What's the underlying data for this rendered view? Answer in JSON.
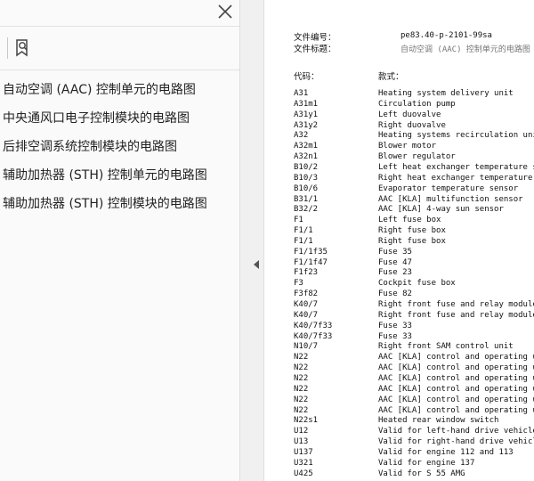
{
  "sidebar": {
    "toc": [
      "自动空调 (AAC) 控制单元的电路图",
      "中央通风口电子控制模块的电路图",
      "后排空调系统控制模块的电路图",
      "辅助加热器 (STH) 控制单元的电路图",
      "辅助加热器 (STH) 控制模块的电路图"
    ]
  },
  "document": {
    "doc_number_label": "文件编号：",
    "doc_number_value": "pe83.40-p-2101-99sa",
    "doc_title_label": "文件标题：",
    "doc_title_value": "自动空调 (AAC) 控制单元的电路图",
    "col_code": "代码：",
    "col_model": "款式：",
    "rows": [
      {
        "code": "A31",
        "desc": "Heating system delivery unit"
      },
      {
        "code": "A31m1",
        "desc": "Circulation pump"
      },
      {
        "code": "A31y1",
        "desc": "Left duovalve"
      },
      {
        "code": "A31y2",
        "desc": "Right duovalve"
      },
      {
        "code": "A32",
        "desc": "Heating systems recirculation unit"
      },
      {
        "code": "A32m1",
        "desc": "Blower motor"
      },
      {
        "code": "A32n1",
        "desc": "Blower regulator"
      },
      {
        "code": "B10/2",
        "desc": "Left heat exchanger temperature sensor"
      },
      {
        "code": "B10/3",
        "desc": "Right heat exchanger temperature sensor"
      },
      {
        "code": "B10/6",
        "desc": "Evaporator temperature sensor"
      },
      {
        "code": "B31/1",
        "desc": "AAC [KLA] multifunction sensor"
      },
      {
        "code": "B32/2",
        "desc": "AAC [KLA] 4-way sun sensor"
      },
      {
        "code": "F1",
        "desc": "Left fuse box"
      },
      {
        "code": "F1/1",
        "desc": "Right fuse box"
      },
      {
        "code": "F1/1",
        "desc": "Right fuse box"
      },
      {
        "code": "F1/1f35",
        "desc": "Fuse 35"
      },
      {
        "code": "F1/1f47",
        "desc": "Fuse 47"
      },
      {
        "code": "F1f23",
        "desc": "Fuse 23"
      },
      {
        "code": "F3",
        "desc": "Cockpit fuse box"
      },
      {
        "code": "F3f82",
        "desc": "Fuse 82"
      },
      {
        "code": "K40/7",
        "desc": "Right front fuse and relay module"
      },
      {
        "code": "K40/7",
        "desc": "Right front fuse and relay module"
      },
      {
        "code": "K40/7f33",
        "desc": "Fuse 33"
      },
      {
        "code": "K40/7f33",
        "desc": "Fuse 33"
      },
      {
        "code": "N10/7",
        "desc": "Right front SAM control unit"
      },
      {
        "code": "N22",
        "desc": "AAC [KLA] control and operating unit"
      },
      {
        "code": "N22",
        "desc": "AAC [KLA] control and operating unit"
      },
      {
        "code": "N22",
        "desc": "AAC [KLA] control and operating unit"
      },
      {
        "code": "N22",
        "desc": "AAC [KLA] control and operating unit"
      },
      {
        "code": "N22",
        "desc": "AAC [KLA] control and operating unit"
      },
      {
        "code": "N22",
        "desc": "AAC [KLA] control and operating unit"
      },
      {
        "code": "N22s1",
        "desc": "Heated rear window switch"
      },
      {
        "code": "U12",
        "desc": "Valid for left-hand drive vehicles"
      },
      {
        "code": "U13",
        "desc": "Valid for right-hand drive vehicles"
      },
      {
        "code": "U137",
        "desc": "Valid for engine 112 and 113"
      },
      {
        "code": "U321",
        "desc": "Valid for engine 137"
      },
      {
        "code": "U425",
        "desc": "Valid for S 55 AMG"
      }
    ]
  }
}
